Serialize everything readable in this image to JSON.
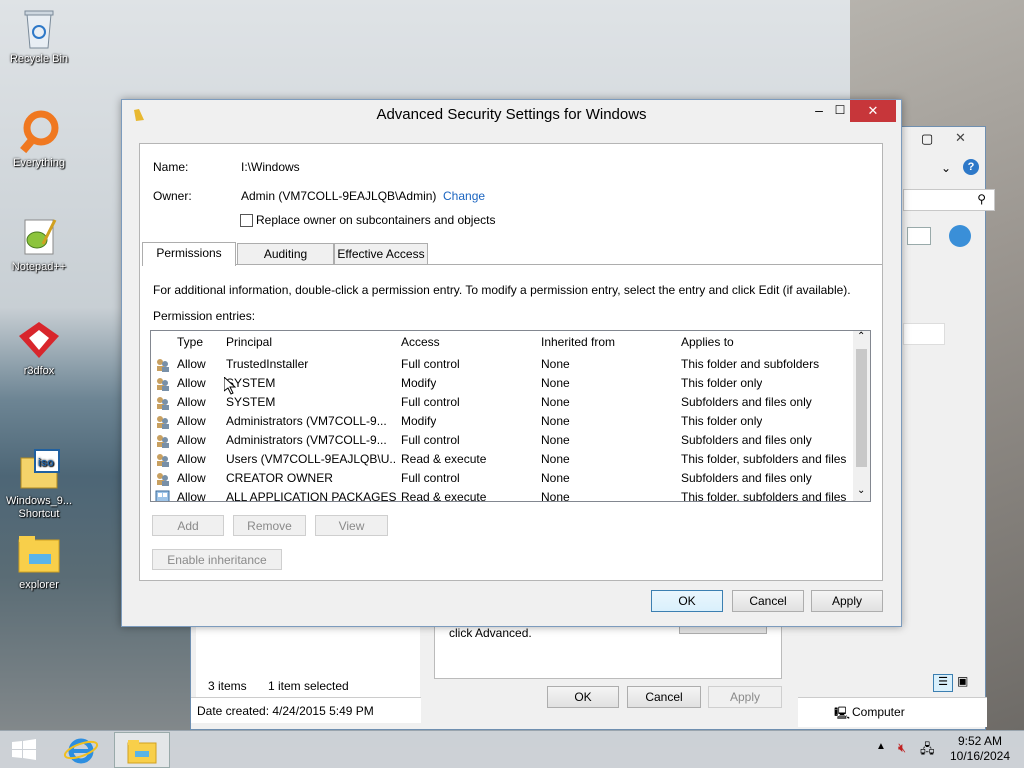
{
  "desktop": {
    "icons": [
      {
        "label": "Recycle Bin"
      },
      {
        "label": "Everything"
      },
      {
        "label": "Notepad++"
      },
      {
        "label": "r3dfox"
      },
      {
        "label": "Windows_9...\nShortcut"
      },
      {
        "label": "explorer"
      }
    ]
  },
  "bg_window": {
    "status_items": "3 items",
    "status_selected": "1 item selected",
    "date_created": "Date created: 4/24/2015 5:49 PM",
    "computer": "Computer",
    "inner_text": "click Advanced.",
    "ok": "OK",
    "cancel": "Cancel",
    "apply": "Apply"
  },
  "dialog": {
    "title": "Advanced Security Settings for Windows",
    "name_label": "Name:",
    "name_value": "I:\\Windows",
    "owner_label": "Owner:",
    "owner_value": "Admin (VM7COLL-9EAJLQB\\Admin)",
    "change_link": "Change",
    "replace_owner_label": "Replace owner on subcontainers and objects",
    "tabs": [
      "Permissions",
      "Auditing",
      "Effective Access"
    ],
    "info_text": "For additional information, double-click a permission entry. To modify a permission entry, select the entry and click Edit (if available).",
    "entries_label": "Permission entries:",
    "columns": [
      "Type",
      "Principal",
      "Access",
      "Inherited from",
      "Applies to"
    ],
    "rows": [
      [
        "Allow",
        "TrustedInstaller",
        "Full control",
        "None",
        "This folder and subfolders"
      ],
      [
        "Allow",
        "SYSTEM",
        "Modify",
        "None",
        "This folder only"
      ],
      [
        "Allow",
        "SYSTEM",
        "Full control",
        "None",
        "Subfolders and files only"
      ],
      [
        "Allow",
        "Administrators (VM7COLL-9...",
        "Modify",
        "None",
        "This folder only"
      ],
      [
        "Allow",
        "Administrators (VM7COLL-9...",
        "Full control",
        "None",
        "Subfolders and files only"
      ],
      [
        "Allow",
        "Users (VM7COLL-9EAJLQB\\U...",
        "Read & execute",
        "None",
        "This folder, subfolders and files"
      ],
      [
        "Allow",
        "CREATOR OWNER",
        "Full control",
        "None",
        "Subfolders and files only"
      ],
      [
        "Allow",
        "ALL APPLICATION PACKAGES",
        "Read & execute",
        "None",
        "This folder, subfolders and files"
      ]
    ],
    "add": "Add",
    "remove": "Remove",
    "view": "View",
    "enable_inheritance": "Enable inheritance",
    "ok": "OK",
    "cancel": "Cancel",
    "apply": "Apply"
  },
  "taskbar": {
    "time": "9:52 AM",
    "date": "10/16/2024"
  }
}
